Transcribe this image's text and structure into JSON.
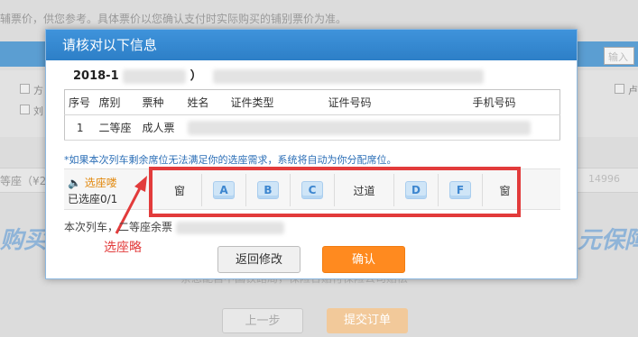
{
  "background": {
    "notice": "辅票价，供您参考。具体票价以您确认支付时实际购买的铺别票价为准。",
    "check_labels": [
      "方",
      "刘"
    ],
    "right_check_label": "卢",
    "search_placeholder": "输入",
    "seat_row_text": "等座（¥2",
    "phone_text": "14996",
    "banner_left": "购买",
    "banner_right": "元保障",
    "faint_text": "亲您配自中国铁路局，保险合赔付保险公司赔偿",
    "prev_button": "上一步",
    "submit_button": "提交订单"
  },
  "modal": {
    "title": "请核对以下信息",
    "trip_date_prefix": "2018-1",
    "trip_paren": "）"
  },
  "table": {
    "headers": [
      "序号",
      "席别",
      "票种",
      "姓名",
      "证件类型",
      "证件号码",
      "手机号码"
    ],
    "rows": [
      {
        "index": "1",
        "seat_class": "二等座",
        "ticket_type": "成人票"
      }
    ]
  },
  "note": "*如果本次列车剩余席位无法满足你的选座需求，系统将自动为你分配席位。",
  "seat_selection": {
    "title": "选座喽",
    "selected": "已选座0/1",
    "left_window": "窗",
    "seats_left": [
      "A",
      "B",
      "C"
    ],
    "aisle": "过道",
    "seats_right": [
      "D",
      "F"
    ],
    "right_window": "窗"
  },
  "remaining": "本次列车，二等座余票",
  "annotation": "选座略",
  "buttons": {
    "back": "返回修改",
    "confirm": "确认"
  },
  "colors": {
    "header_blue": "#2d7fc7",
    "confirm_orange": "#ff8a1f",
    "highlight_red": "#e23b3b",
    "note_blue": "#2c6fb7",
    "seat_title_orange": "#e2890f"
  }
}
